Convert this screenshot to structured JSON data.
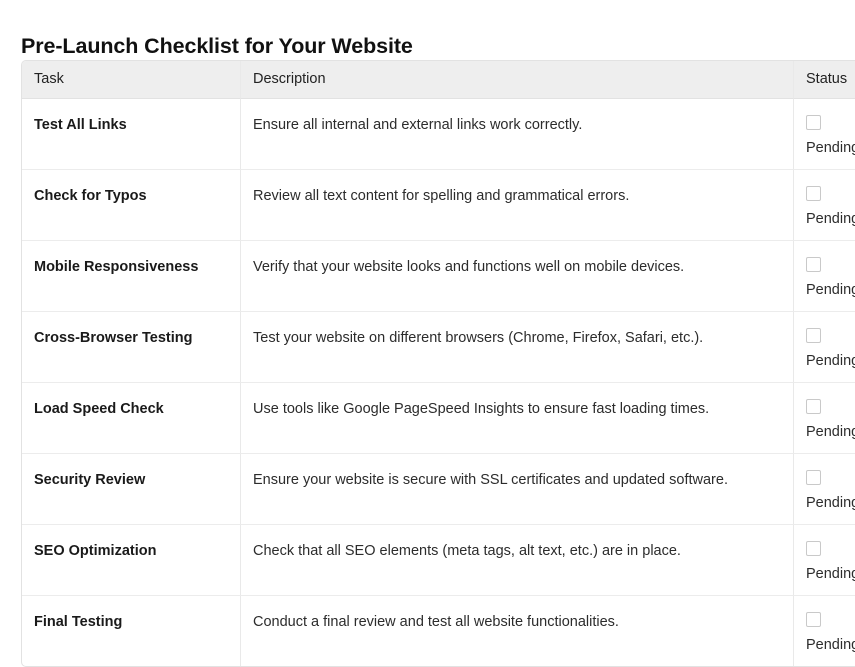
{
  "page_title": "Pre-Launch Checklist for Your Website",
  "table": {
    "columns": [
      {
        "key": "task",
        "label": "Task"
      },
      {
        "key": "description",
        "label": "Description"
      },
      {
        "key": "status",
        "label": "Status"
      }
    ],
    "rows": [
      {
        "task": "Test All Links",
        "description": "Ensure all internal and external links work correctly.",
        "status_label": "Pending",
        "checked": false,
        "checkbox_icon": "checkbox-empty-icon"
      },
      {
        "task": "Check for Typos",
        "description": "Review all text content for spelling and grammatical errors.",
        "status_label": "Pending",
        "checked": false,
        "checkbox_icon": "checkbox-empty-icon"
      },
      {
        "task": "Mobile Responsiveness",
        "description": "Verify that your website looks and functions well on mobile devices.",
        "status_label": "Pending",
        "checked": false,
        "checkbox_icon": "checkbox-empty-icon"
      },
      {
        "task": "Cross-Browser Testing",
        "description": "Test your website on different browsers (Chrome, Firefox, Safari, etc.).",
        "status_label": "Pending",
        "checked": false,
        "checkbox_icon": "checkbox-empty-icon"
      },
      {
        "task": "Load Speed Check",
        "description": "Use tools like Google PageSpeed Insights to ensure fast loading times.",
        "status_label": "Pending",
        "checked": false,
        "checkbox_icon": "checkbox-empty-icon"
      },
      {
        "task": "Security Review",
        "description": "Ensure your website is secure with SSL certificates and updated software.",
        "status_label": "Pending",
        "checked": false,
        "checkbox_icon": "checkbox-empty-icon"
      },
      {
        "task": "SEO Optimization",
        "description": "Check that all SEO elements (meta tags, alt text, etc.) are in place.",
        "status_label": "Pending",
        "checked": false,
        "checkbox_icon": "checkbox-empty-icon"
      },
      {
        "task": "Final Testing",
        "description": "Conduct a final review and test all website functionalities.",
        "status_label": "Pending",
        "checked": false,
        "checkbox_icon": "checkbox-empty-icon"
      }
    ]
  },
  "colors": {
    "header_background": "#eeeeee",
    "border": "#e2e2e2",
    "row_divider": "#ececec",
    "checkbox_border": "#c9c9c9",
    "text_primary": "#1a1a1a",
    "text_secondary": "#2c2c2c",
    "page_background": "#ffffff"
  }
}
